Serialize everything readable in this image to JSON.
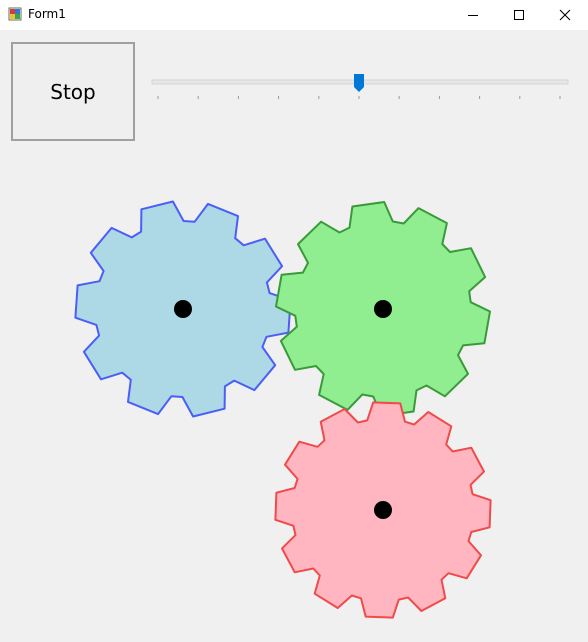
{
  "window": {
    "title": "Form1",
    "min_icon": "minimize-icon",
    "max_icon": "maximize-icon",
    "close_icon": "close-icon"
  },
  "controls": {
    "stop_label": "Stop",
    "speed_slider": {
      "min": 0,
      "max": 10,
      "value": 5,
      "tick_count": 11
    }
  },
  "gears": [
    {
      "name": "blue-gear",
      "fill": "#add8e6",
      "stroke": "#4b5ef5",
      "teeth": 10
    },
    {
      "name": "green-gear",
      "fill": "#90ee90",
      "stroke": "#3a9a3a",
      "teeth": 10
    },
    {
      "name": "pink-gear",
      "fill": "#ffb6c1",
      "stroke": "#f04a4a",
      "teeth": 12
    }
  ],
  "colors": {
    "window_bg": "#f0f0f0",
    "slider_thumb": "#0078d7",
    "hub": "#000000"
  }
}
